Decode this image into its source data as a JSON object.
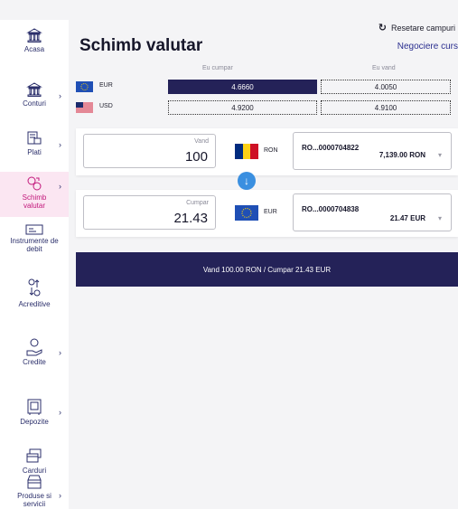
{
  "sidebar": {
    "items": [
      {
        "label": "Acasa",
        "icon": "bank-icon"
      },
      {
        "label": "Conturi",
        "icon": "bank-icon"
      },
      {
        "label": "Plati",
        "icon": "payment-icon"
      },
      {
        "label": "Schimb valutar",
        "icon": "currency-exchange-icon"
      },
      {
        "label": "Instrumente de debit",
        "icon": "debit-instrument-icon"
      },
      {
        "label": "Acreditive",
        "icon": "letter-of-credit-icon"
      },
      {
        "label": "Credite",
        "icon": "credit-icon"
      },
      {
        "label": "Depozite",
        "icon": "deposit-icon"
      },
      {
        "label": "Carduri",
        "icon": "card-icon"
      },
      {
        "label": "Produse si servicii",
        "icon": "products-icon"
      }
    ]
  },
  "header": {
    "reset_label": "Resetare campuri",
    "title": "Schimb valutar",
    "negotiate_label": "Negociere curs"
  },
  "rates": {
    "buy_header": "Eu cumpar",
    "sell_header": "Eu vand",
    "rows": [
      {
        "currency": "EUR",
        "buy": "4.6660",
        "sell": "4.0050"
      },
      {
        "currency": "USD",
        "buy": "4.9200",
        "sell": "4.9100"
      }
    ]
  },
  "sell": {
    "label": "Vand",
    "amount": "100",
    "currency": "RON",
    "account": "RO...0000704822",
    "balance": "7,139.00 RON"
  },
  "buy": {
    "label": "Cumpar",
    "amount": "21.43",
    "currency": "EUR",
    "account": "RO...0000704838",
    "balance": "21.47 EUR"
  },
  "summary_label": "Vand 100.00 RON / Cumpar 21.43 EUR",
  "colors": {
    "accent": "#242258",
    "active_nav": "#c2177b",
    "swap": "#3a8fe0"
  }
}
